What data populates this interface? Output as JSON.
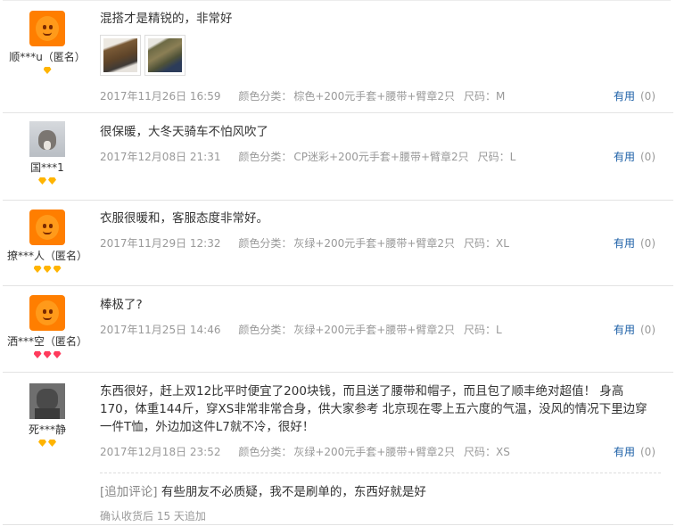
{
  "reviews": [
    {
      "user": "顺***u（匿名）",
      "avatar": "taobao-anon-avatar",
      "rank_count": 1,
      "rank_color": "#ffb400",
      "text": "混搭才是精锐的，非常好",
      "photos": [
        "photo-1",
        "photo-2"
      ],
      "date": "2017年11月26日 16:59",
      "sku_label": "颜色分类：",
      "sku_value": "棕色+200元手套+腰带+臂章2只",
      "size": "尺码：M",
      "useful_label": "有用",
      "useful_count": "(0)"
    },
    {
      "user": "国***1",
      "avatar": "cat-avatar",
      "rank_count": 2,
      "rank_color": "#ffb400",
      "text": "很保暖，大冬天骑车不怕风吹了",
      "date": "2017年12月08日 21:31",
      "sku_label": "颜色分类：",
      "sku_value": "CP迷彩+200元手套+腰带+臂章2只",
      "size": "尺码：L",
      "useful_label": "有用",
      "useful_count": "(0)"
    },
    {
      "user": "撩***人（匿名）",
      "avatar": "taobao-anon-avatar",
      "rank_count": 3,
      "rank_color": "#ffb400",
      "text": "衣服很暖和，客服态度非常好。",
      "date": "2017年11月29日 12:32",
      "sku_label": "颜色分类：",
      "sku_value": "灰绿+200元手套+腰带+臂章2只",
      "size": "尺码：XL",
      "useful_label": "有用",
      "useful_count": "(0)"
    },
    {
      "user": "洒***空（匿名）",
      "avatar": "taobao-anon-avatar",
      "rank_count": 3,
      "rank_color": "#ff3b5c",
      "text": "棒极了?",
      "date": "2017年11月25日 14:46",
      "sku_label": "颜色分类：",
      "sku_value": "灰绿+200元手套+腰带+臂章2只",
      "size": "尺码：L",
      "useful_label": "有用",
      "useful_count": "(0)"
    },
    {
      "user": "死***静",
      "avatar": "dog-avatar",
      "rank_count": 2,
      "rank_color": "#ffb400",
      "text": "东西很好，赶上双12比平时便宜了200块钱，而且送了腰带和帽子，而且包了顺丰绝对超值！ 身高170，体重144斤，穿XS非常非常合身，供大家参考 北京现在零上五六度的气温，没风的情况下里边穿一件T恤，外边加这件L7就不冷，很好！",
      "date": "2017年12月18日 23:52",
      "sku_label": "颜色分类：",
      "sku_value": "灰绿+200元手套+腰带+臂章2只",
      "size": "尺码：XS",
      "useful_label": "有用",
      "useful_count": "(0)",
      "append_tag": "[追加评论]",
      "append_text": "有些朋友不必质疑，我不是刷单的，东西好就是好",
      "append_after": "确认收货后 15 天追加"
    }
  ]
}
